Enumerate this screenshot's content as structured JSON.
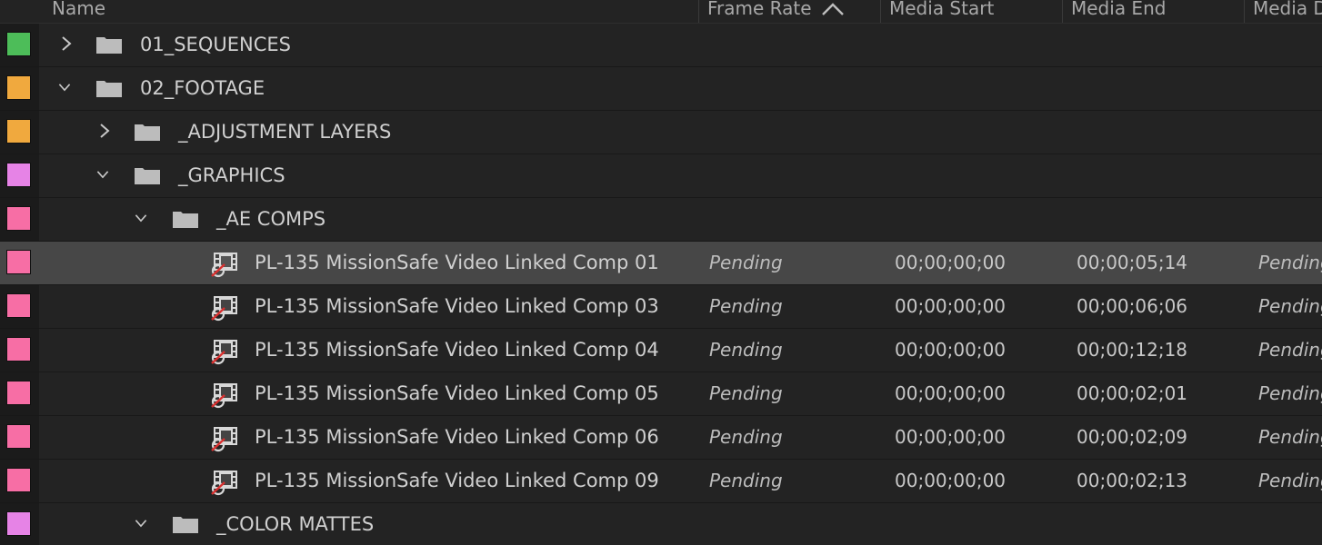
{
  "columns": {
    "name": "Name",
    "frame_rate": "Frame Rate",
    "media_start": "Media Start",
    "media_end": "Media End",
    "media_duration": "Media D"
  },
  "colors": {
    "green": "#4dbd59",
    "orange": "#f0a93e",
    "violet": "#e683e6",
    "rose": "#f76ea5"
  },
  "rows": [
    {
      "name": "01_SEQUENCES",
      "type": "folder",
      "expanded": false,
      "label_color": "#4dbd59"
    },
    {
      "name": "02_FOOTAGE",
      "type": "folder",
      "expanded": true,
      "label_color": "#f0a93e"
    },
    {
      "name": "_ADJUSTMENT LAYERS",
      "type": "folder",
      "expanded": false,
      "label_color": "#f0a93e"
    },
    {
      "name": "_GRAPHICS",
      "type": "folder",
      "expanded": true,
      "label_color": "#e683e6"
    },
    {
      "name": "_AE COMPS",
      "type": "folder",
      "expanded": true,
      "label_color": "#f76ea5"
    },
    {
      "name": "PL-135 MissionSafe Video Linked Comp 01",
      "type": "linked-comp",
      "selected": true,
      "label_color": "#f76ea5",
      "frame_rate": "Pending",
      "media_start": "00;00;00;00",
      "media_end": "00;00;05;14",
      "media_duration": "Pending"
    },
    {
      "name": "PL-135 MissionSafe Video Linked Comp 03",
      "type": "linked-comp",
      "label_color": "#f76ea5",
      "frame_rate": "Pending",
      "media_start": "00;00;00;00",
      "media_end": "00;00;06;06",
      "media_duration": "Pending"
    },
    {
      "name": "PL-135 MissionSafe Video Linked Comp 04",
      "type": "linked-comp",
      "label_color": "#f76ea5",
      "frame_rate": "Pending",
      "media_start": "00;00;00;00",
      "media_end": "00;00;12;18",
      "media_duration": "Pending"
    },
    {
      "name": "PL-135 MissionSafe Video Linked Comp 05",
      "type": "linked-comp",
      "label_color": "#f76ea5",
      "frame_rate": "Pending",
      "media_start": "00;00;00;00",
      "media_end": "00;00;02;01",
      "media_duration": "Pending"
    },
    {
      "name": "PL-135 MissionSafe Video Linked Comp 06",
      "type": "linked-comp",
      "label_color": "#f76ea5",
      "frame_rate": "Pending",
      "media_start": "00;00;00;00",
      "media_end": "00;00;02;09",
      "media_duration": "Pending"
    },
    {
      "name": "PL-135 MissionSafe Video Linked Comp 09",
      "type": "linked-comp",
      "label_color": "#f76ea5",
      "frame_rate": "Pending",
      "media_start": "00;00;00;00",
      "media_end": "00;00;02;13",
      "media_duration": "Pending"
    },
    {
      "name": "_COLOR MATTES",
      "type": "folder",
      "expanded": true,
      "label_color": "#e683e6"
    }
  ]
}
